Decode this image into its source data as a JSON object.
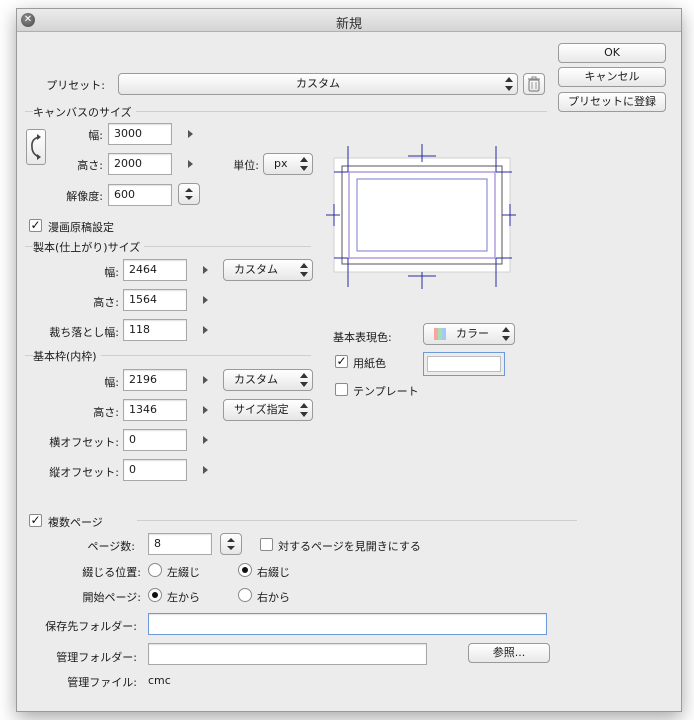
{
  "window": {
    "title": "新規"
  },
  "buttons": {
    "ok": "OK",
    "cancel": "キャンセル",
    "register_preset": "プリセットに登録",
    "browse": "参照..."
  },
  "preset": {
    "label": "プリセット:",
    "value": "カスタム"
  },
  "canvas": {
    "section": "キャンバスのサイズ",
    "width_label": "幅:",
    "width": "3000",
    "height_label": "高さ:",
    "height": "2000",
    "resolution_label": "解像度:",
    "resolution": "600",
    "unit_label": "単位:",
    "unit": "px"
  },
  "manga": {
    "label": "漫画原稿設定",
    "checked": true
  },
  "finish": {
    "section": "製本(仕上がり)サイズ",
    "width_label": "幅:",
    "width": "2464",
    "size_preset": "カスタム",
    "height_label": "高さ:",
    "height": "1564",
    "bleed_label": "裁ち落とし幅:",
    "bleed": "118"
  },
  "inner": {
    "section": "基本枠(内枠)",
    "width_label": "幅:",
    "width": "2196",
    "size_preset": "カスタム",
    "height_label": "高さ:",
    "height": "1346",
    "size_mode": "サイズ指定",
    "xoffset_label": "横オフセット:",
    "xoffset": "0",
    "yoffset_label": "縦オフセット:",
    "yoffset": "0"
  },
  "color": {
    "label": "基本表現色:",
    "value": "カラー"
  },
  "paper": {
    "label": "用紙色",
    "checked": true,
    "color": "#ffffff"
  },
  "template": {
    "label": "テンプレート",
    "checked": false
  },
  "pages": {
    "multi_label": "複数ページ",
    "multi_checked": true,
    "count_label": "ページ数:",
    "count": "8",
    "spread_label": "対するページを見開きにする",
    "binding_label": "綴じる位置:",
    "binding_left": "左綴じ",
    "binding_right": "右綴じ",
    "binding_selected": "right",
    "start_label": "開始ページ:",
    "start_left": "左から",
    "start_right": "右から",
    "start_selected": "left"
  },
  "folders": {
    "save_label": "保存先フォルダー:",
    "save_value": "",
    "manage_label": "管理フォルダー:",
    "manage_value": "",
    "file_label": "管理ファイル:",
    "file_value": "cmc"
  },
  "icons": {
    "close": "close-icon",
    "trash": "trash-icon",
    "rotate": "rotate-icon",
    "swatch": "color-swatch-icon"
  },
  "accent": "#5a8fd6"
}
